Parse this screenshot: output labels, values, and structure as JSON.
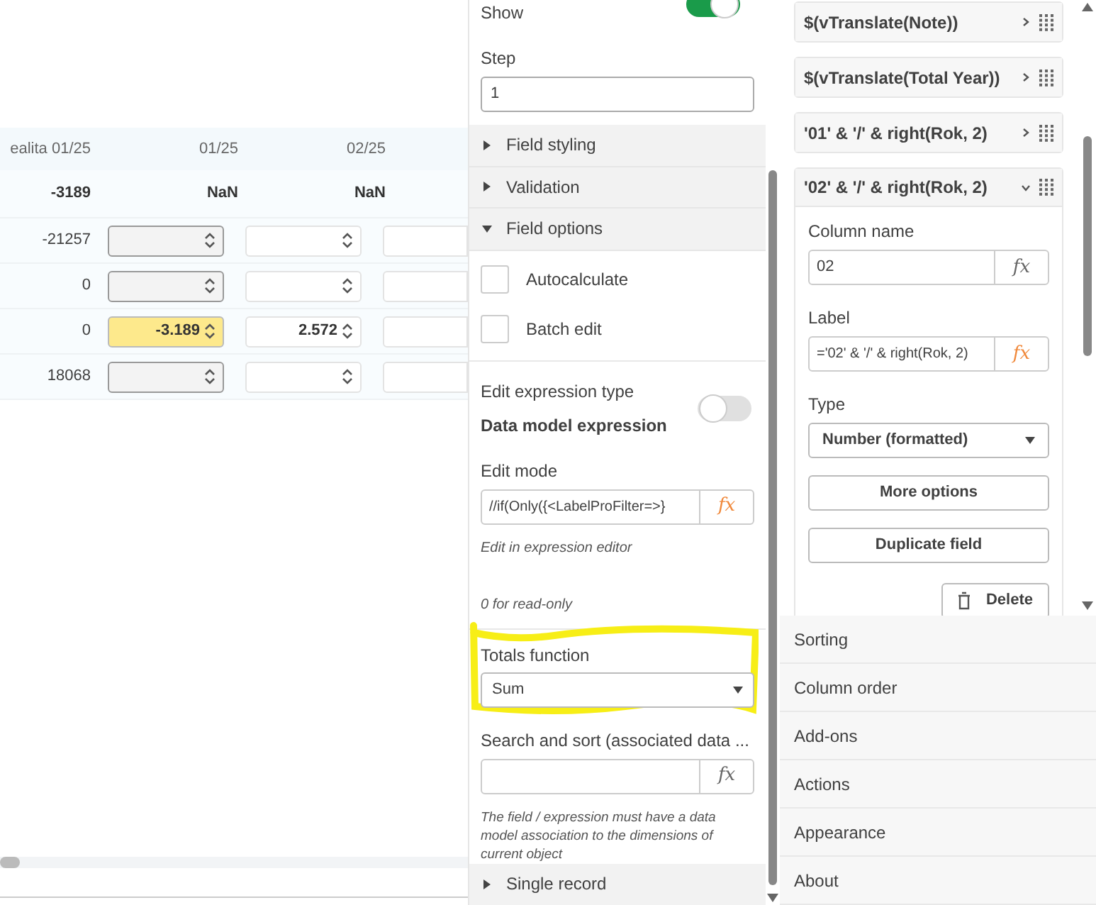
{
  "table": {
    "columns": [
      "ealita 01/25",
      "01/25",
      "02/25"
    ],
    "totals": [
      "-3189",
      "NaN",
      "NaN"
    ],
    "rows": [
      {
        "value": "-21257",
        "input_1": {
          "kind": "locked"
        },
        "input_2": {
          "kind": "open"
        }
      },
      {
        "value": "0",
        "input_1": {
          "kind": "locked"
        },
        "input_2": {
          "kind": "open"
        }
      },
      {
        "value": "0",
        "input_1": {
          "kind": "edited",
          "value": "-3.189"
        },
        "input_2": {
          "kind": "open",
          "value": "2.572"
        }
      },
      {
        "value": "18068",
        "input_1": {
          "kind": "locked"
        },
        "input_2": {
          "kind": "open"
        }
      }
    ]
  },
  "field_panel": {
    "show": {
      "label": "Show",
      "on": true
    },
    "step": {
      "label": "Step",
      "value": "1"
    },
    "sections": [
      {
        "label": "Field styling",
        "expanded": false
      },
      {
        "label": "Validation",
        "expanded": false
      },
      {
        "label": "Field options",
        "expanded": true
      }
    ],
    "checkboxes": [
      {
        "label": "Autocalculate",
        "checked": false
      },
      {
        "label": "Batch edit",
        "checked": false
      }
    ],
    "expression_type": {
      "label": "Edit expression type",
      "value": "Data model expression",
      "on": false
    },
    "edit_mode": {
      "label": "Edit mode",
      "value": "//if(Only({<LabelProFilter=>}",
      "fx": {
        "text": "fx",
        "active": true
      },
      "hint": "Edit in expression editor",
      "note": "0 for read-only"
    },
    "totals_function": {
      "label": "Totals function",
      "value": "Sum",
      "highlighted": true
    },
    "search_sort": {
      "label": "Search and sort (associated data ...",
      "fx": {
        "text": "fx",
        "active": false
      },
      "note": "The field / expression must have a data model association to the dimensions of current object"
    },
    "single_record": {
      "label": "Single record",
      "expanded": false
    }
  },
  "columns_panel": {
    "columns": [
      {
        "label": "$(vTranslate(Note))",
        "expanded": false
      },
      {
        "label": "$(vTranslate(Total Year))",
        "expanded": false
      },
      {
        "label": "'01' & '/' & right(Rok, 2)",
        "expanded": false
      },
      {
        "label": "'02' & '/' & right(Rok, 2)",
        "expanded": true
      }
    ],
    "column_name": {
      "label": "Column name",
      "value": "02",
      "fx": {
        "text": "fx",
        "active": false
      }
    },
    "label_field": {
      "label": "Label",
      "value": "='02' & '/' & right(Rok, 2)",
      "fx": {
        "text": "fx",
        "active": true
      }
    },
    "type": {
      "label": "Type",
      "value": "Number (formatted)"
    },
    "buttons": [
      "More options",
      "Duplicate field"
    ],
    "delete": "Delete"
  },
  "menu": [
    "Sorting",
    "Column order",
    "Add-ons",
    "Actions",
    "Appearance",
    "About"
  ]
}
